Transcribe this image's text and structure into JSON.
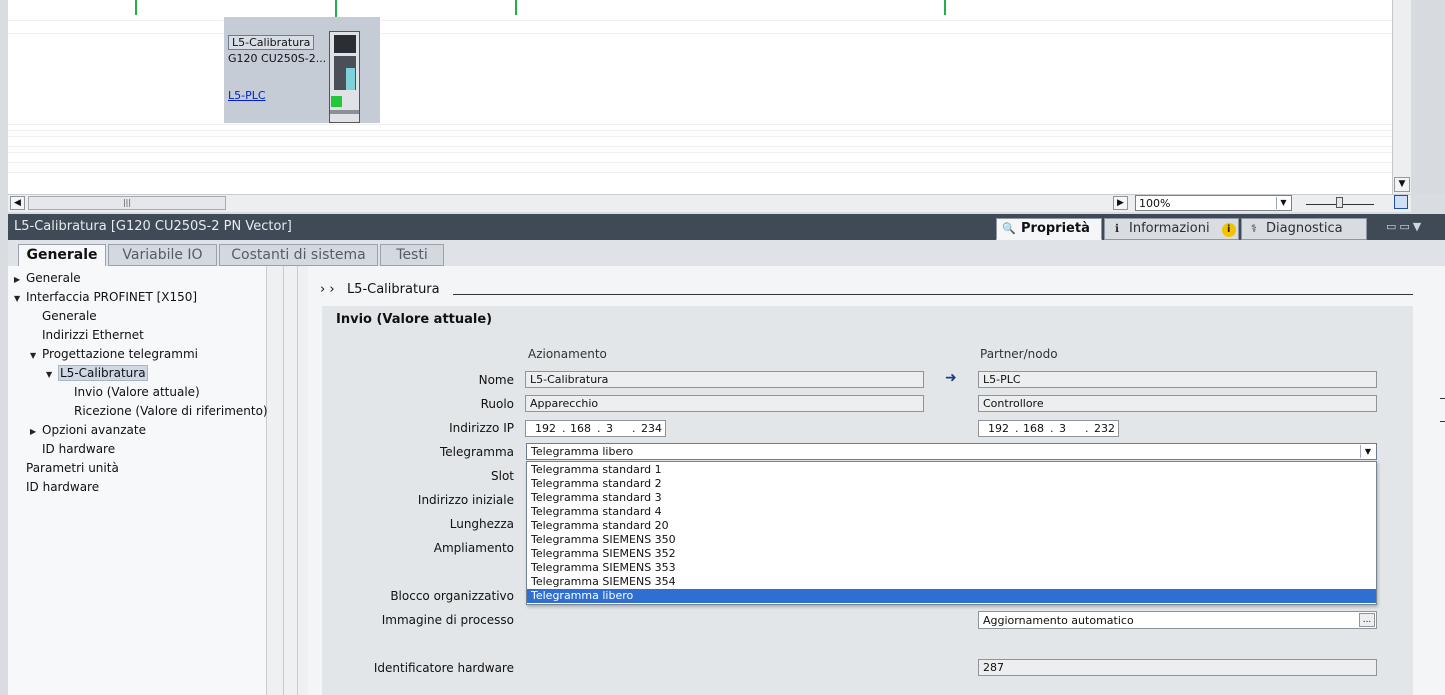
{
  "device_view": {
    "device_name": "L5-Calibratura",
    "device_type": "G120 CU250S-2...",
    "plc_link": "L5-PLC",
    "zoom": "100%"
  },
  "inspector": {
    "title": "L5-Calibratura [G120 CU250S-2 PN Vector]",
    "tabs": [
      {
        "label": "Proprietà",
        "icon": "properties-icon"
      },
      {
        "label": "Informazioni",
        "icon": "info-icon"
      },
      {
        "label": "Diagnostica",
        "icon": "diagnostics-icon"
      }
    ],
    "info_badge": "i",
    "subtabs": [
      "Generale",
      "Variabile IO",
      "Costanti di sistema",
      "Testi"
    ]
  },
  "nav": {
    "items": [
      {
        "label": "Generale",
        "arrow": "▶"
      },
      {
        "label": "Interfaccia PROFINET [X150]",
        "arrow": "▼"
      },
      {
        "label": "Generale",
        "arrow": ""
      },
      {
        "label": "Indirizzi Ethernet",
        "arrow": ""
      },
      {
        "label": "Progettazione telegrammi",
        "arrow": "▼"
      },
      {
        "label": "L5-Calibratura",
        "arrow": "▼"
      },
      {
        "label": "Invio (Valore attuale)",
        "arrow": ""
      },
      {
        "label": "Ricezione (Valore di riferimento)",
        "arrow": ""
      },
      {
        "label": "Opzioni avanzate",
        "arrow": "▶"
      },
      {
        "label": "ID hardware",
        "arrow": ""
      },
      {
        "label": "Parametri unità",
        "arrow": ""
      },
      {
        "label": "ID hardware",
        "arrow": ""
      }
    ]
  },
  "content": {
    "breadcrumb": "L5-Calibratura",
    "breadcrumb_prefix": "› ›",
    "section_title": "Invio (Valore attuale)",
    "col_drive": "Azionamento",
    "col_partner": "Partner/nodo",
    "labels": {
      "name": "Nome",
      "role": "Ruolo",
      "ip": "Indirizzo IP",
      "telegram": "Telegramma",
      "slot": "Slot",
      "start_address": "Indirizzo iniziale",
      "length": "Lunghezza",
      "extension": "Ampliamento",
      "ob": "Blocco organizzativo",
      "process_image": "Immagine di processo",
      "hw_id": "Identificatore hardware"
    },
    "drive": {
      "name": "L5-Calibratura",
      "role": "Apparecchio",
      "ip": [
        "192",
        "168",
        "3",
        "234"
      ]
    },
    "partner": {
      "name": "L5-PLC",
      "role": "Controllore",
      "ip": [
        "192",
        "168",
        "3",
        "232"
      ],
      "process_image": "Aggiornamento automatico",
      "hw_id": "287"
    },
    "telegram_value": "Telegramma libero",
    "telegram_options": [
      "Telegramma standard 1",
      "Telegramma standard 2",
      "Telegramma standard 3",
      "Telegramma standard 4",
      "Telegramma standard 20",
      "Telegramma SIEMENS 350",
      "Telegramma SIEMENS 352",
      "Telegramma SIEMENS 353",
      "Telegramma SIEMENS 354",
      "Telegramma libero"
    ],
    "telegram_selected_index": 9,
    "process_image_button": "..."
  },
  "colors": {
    "header_bg": "#3f4a56",
    "selection": "#2f6fd1",
    "bus_line": "#22b04b"
  }
}
